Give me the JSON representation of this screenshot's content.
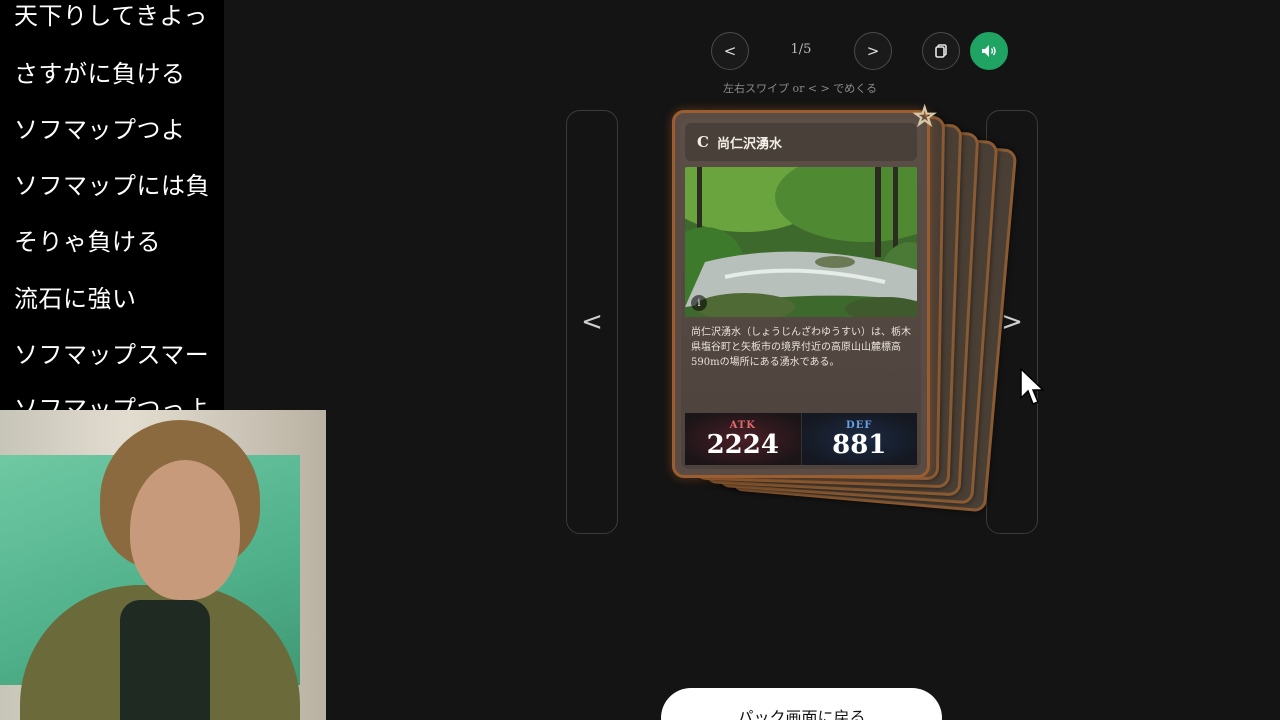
{
  "comments": [
    "天下りしてきよっ",
    "さすがに負ける",
    "ソフマップつよ",
    "ソフマップには負",
    "そりゃ負ける",
    "流石に強い",
    "ソフマップスマー",
    "ソフマップつっよ"
  ],
  "controls": {
    "prev_label": "<",
    "next_label": ">",
    "counter": "1/5",
    "hint": "左右スワイプ or < > でめくる",
    "copy_icon": "copy-icon",
    "sound_icon": "speaker-icon",
    "sound_color": "#1fa463"
  },
  "side_nav": {
    "left_label": "<",
    "right_label": ">"
  },
  "card": {
    "rarity": "C",
    "name": "尚仁沢湧水",
    "info_label": "i",
    "description": "尚仁沢湧水（しょうじんざわゆうすい）は、栃木県塩谷町と矢板市の境界付近の高原山山麓標高590mの場所にある湧水である。",
    "atk_label": "ATK",
    "atk_value": "2224",
    "def_label": "DEF",
    "def_value": "881",
    "star_icon": "star-icon",
    "frame_color": "#9a5e30"
  },
  "footer": {
    "back_button": "パック画面に戻る"
  }
}
